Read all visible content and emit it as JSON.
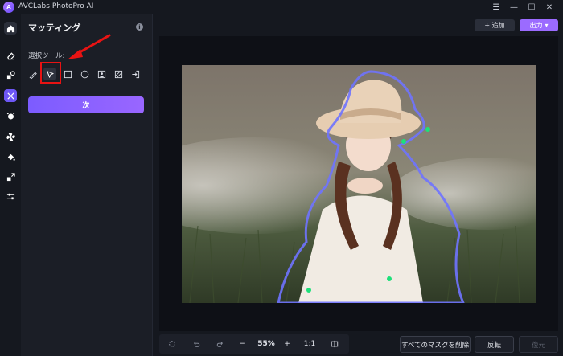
{
  "window": {
    "logo_text": "A",
    "title": "AVCLabs PhotoPro AI",
    "menu_glyph": "☰",
    "minimize_glyph": "—",
    "maximize_glyph": "☐",
    "close_glyph": "✕"
  },
  "rail": {
    "items": [
      {
        "icon": "home-icon"
      },
      {
        "icon": "eraser-icon"
      },
      {
        "icon": "shapes-icon"
      },
      {
        "icon": "matting-icon",
        "active": true
      },
      {
        "icon": "face-icon"
      },
      {
        "icon": "fan-icon"
      },
      {
        "icon": "fill-icon"
      },
      {
        "icon": "resize-icon"
      },
      {
        "icon": "sliders-icon"
      }
    ],
    "active_color": "#6d57f5"
  },
  "panel": {
    "title": "マッティング",
    "info_glyph": "i",
    "tool_label": "選択ツール:",
    "tools": [
      {
        "icon": "brush-icon"
      },
      {
        "icon": "cursor-icon",
        "selected": true
      },
      {
        "icon": "rectangle-icon"
      },
      {
        "icon": "circle-icon"
      },
      {
        "icon": "portrait-icon"
      },
      {
        "icon": "hatch-icon"
      },
      {
        "icon": "import-icon"
      }
    ],
    "next_label": "次"
  },
  "header": {
    "add_label": "+ 追加",
    "export_label": "出力",
    "export_caret": "▾",
    "accent": "#9b6bff"
  },
  "toolbar": {
    "zoom": "55%",
    "minus": "−",
    "plus": "+",
    "ratio": "1:1",
    "clear_masks_label": "すべてのマスクを削除",
    "flip_label": "反転",
    "restore_label": "復元"
  },
  "annotation": {
    "color": "#e81313"
  },
  "mask": {
    "outline_color": "#6f73ff",
    "point_color": "#1ee07a"
  }
}
